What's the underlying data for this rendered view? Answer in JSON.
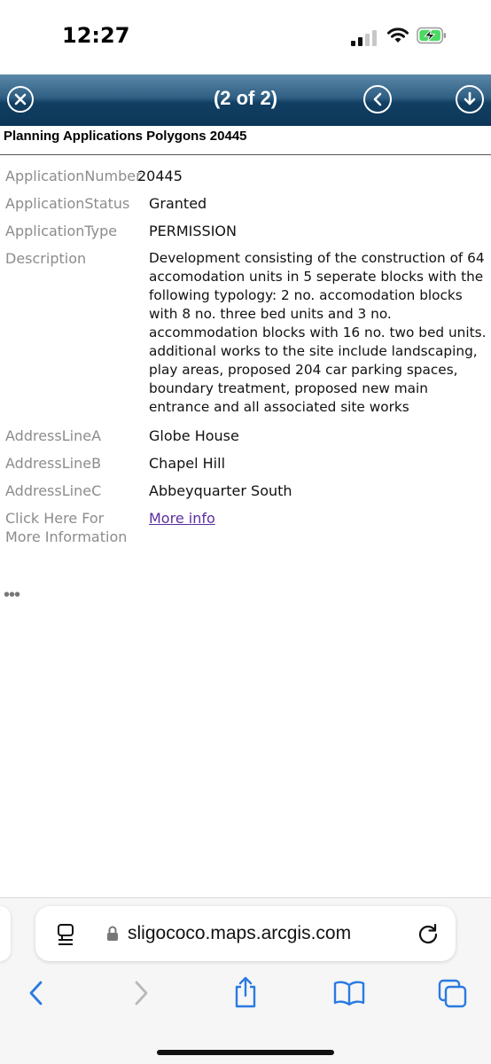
{
  "status_bar": {
    "time": "12:27"
  },
  "popup": {
    "counter": "(2 of 2)",
    "layer_title": "Planning Applications Polygons 20445",
    "fields": [
      {
        "label": "ApplicationNumber",
        "value": "20445"
      },
      {
        "label": "ApplicationStatus",
        "value": "Granted"
      },
      {
        "label": "ApplicationType",
        "value": "PERMISSION"
      },
      {
        "label": "Description",
        "value": "Development consisting of the construction of 64 accomodation units in 5 seperate blocks with the following typology: 2 no. accomodation blocks with 8 no. three bed units and 3 no. accommodation blocks with 16 no. two bed units. additional works to the site include landscaping, play areas, proposed 204 car parking spaces, boundary treatment, proposed new main entrance and all associated site works"
      },
      {
        "label": "AddressLineA",
        "value": "Globe House"
      },
      {
        "label": "AddressLineB",
        "value": "Chapel Hill"
      },
      {
        "label": "AddressLineC",
        "value": "Abbeyquarter South"
      },
      {
        "label": "Click Here For More Information",
        "value": "More info"
      }
    ],
    "overflow": "•••"
  },
  "browser": {
    "url": "sligococo.maps.arcgis.com"
  },
  "colors": {
    "header_top": "#5b88a8",
    "header_bottom": "#0c3657",
    "label_gray": "#8c8c8c",
    "link_purple": "#5b2fa0",
    "ios_blue": "#2a7ae2"
  },
  "icons": [
    "close-icon",
    "back-circle-icon",
    "download-circle-icon",
    "lock-icon",
    "reader-icon",
    "reload-icon",
    "back-chevron-icon",
    "forward-chevron-icon",
    "share-icon",
    "bookmarks-icon",
    "tabs-icon",
    "wifi-icon",
    "battery-charging-icon",
    "signal-icon"
  ]
}
